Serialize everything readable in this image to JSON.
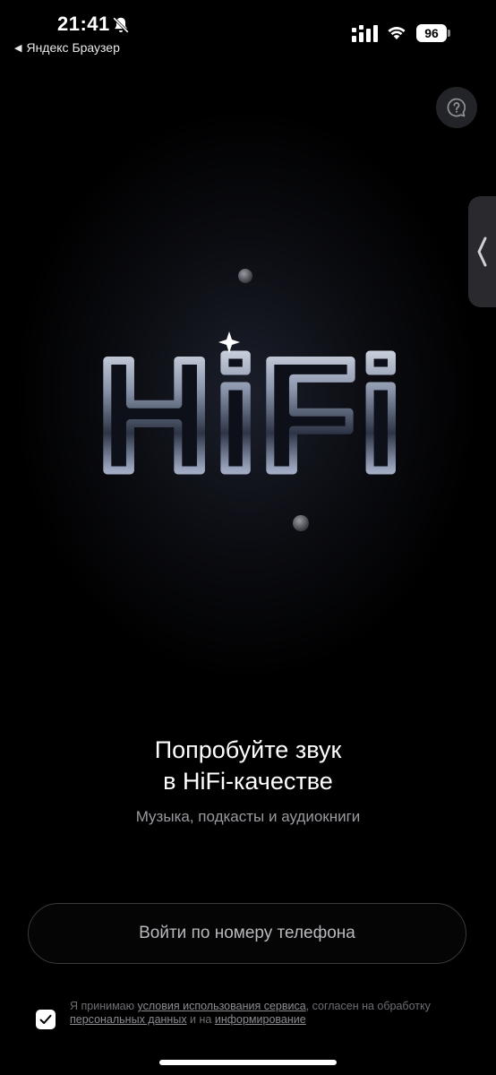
{
  "status_bar": {
    "time": "21:41",
    "back_app": "Яндекс Браузер",
    "battery": "96",
    "icons": [
      "bell-slash-icon",
      "signal-icon",
      "wifi-icon",
      "battery-icon"
    ]
  },
  "hero": {
    "logo_text": "HiFi"
  },
  "promo": {
    "title_line1": "Попробуйте звук",
    "title_line2": "в HiFi-качестве",
    "subtitle": "Музыка, подкасты и аудиокниги"
  },
  "login_button": "Войти по номеру телефона",
  "consent": {
    "checked": true,
    "text_1": "Я принимаю ",
    "link_terms": "условия использования сервиса",
    "text_2": ", согласен на обработку ",
    "link_personal": "персональных данных",
    "text_3": " и на ",
    "link_info": "информирование"
  },
  "colors": {
    "background": "#000000",
    "button_border": "#3a3a3e",
    "muted_text": "#9a9aa0"
  }
}
